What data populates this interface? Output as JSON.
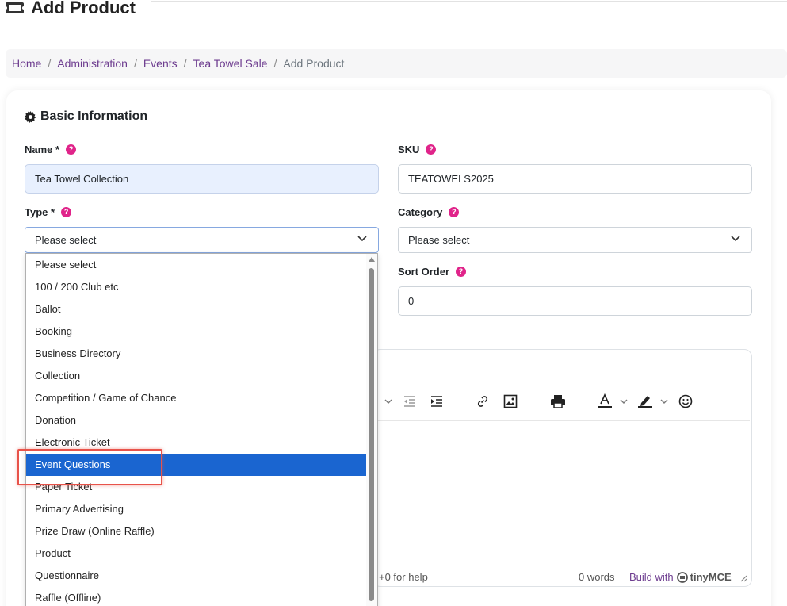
{
  "page": {
    "title": "Add Product"
  },
  "breadcrumb": [
    {
      "label": "Home"
    },
    {
      "label": "Administration"
    },
    {
      "label": "Events"
    },
    {
      "label": "Tea Towel Sale"
    }
  ],
  "breadcrumb_current": "Add Product",
  "section": {
    "title": "Basic Information"
  },
  "fields": {
    "name": {
      "label": "Name *",
      "value": "Tea Towel Collection"
    },
    "sku": {
      "label": "SKU",
      "value": "TEATOWELS2025"
    },
    "type": {
      "label": "Type *",
      "value": "Please select"
    },
    "category": {
      "label": "Category",
      "value": "Please select"
    },
    "sort_order": {
      "label": "Sort Order",
      "value": "0"
    }
  },
  "help_glyph": "?",
  "dropdown": {
    "options": [
      "Please select",
      "100 / 200 Club etc",
      "Ballot",
      "Booking",
      "Business Directory",
      "Collection",
      "Competition / Game of Chance",
      "Donation",
      "Electronic Ticket",
      "Event Questions",
      "Paper Ticket",
      "Primary Advertising",
      "Prize Draw (Online Raffle)",
      "Product",
      "Questionnaire",
      "Raffle (Offline)"
    ],
    "highlighted": "Event Questions"
  },
  "editor": {
    "status_help": "+0 for help",
    "word_count": "0 words",
    "build_with": "Build with",
    "brand": "tinyMCE"
  },
  "colors": {
    "accent": "#6d3c8f",
    "help_badge": "#e0248a",
    "selected": "#1a65d0",
    "highlight_box": "#e8534a"
  }
}
